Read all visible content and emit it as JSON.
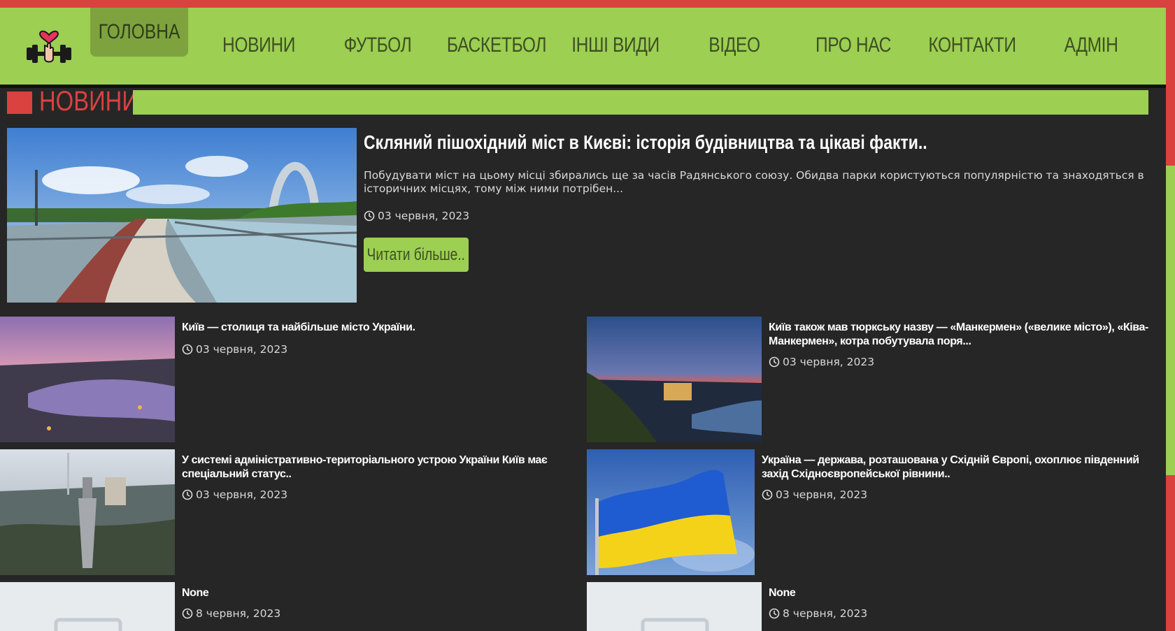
{
  "nav": {
    "items": [
      "ГОЛОВНА",
      "НОВИНИ",
      "ФУТБОЛ",
      "БАСКЕТБОЛ",
      "ІНШІ ВИДИ",
      "ВІДЕО",
      "ПРО НАС",
      "КОНТАКТИ",
      "АДМІН"
    ],
    "active_index": 0
  },
  "logo": {
    "icon": "dumbbell-heart-icon"
  },
  "section": {
    "title": "НОВИНИ"
  },
  "featured": {
    "title": "Скляний пішохідний міст в Києві: історія будівництва та цікаві факти..",
    "description": "Побудувати міст на цьому місці збирались ще за часів Радянського союзу. Обидва парки користуються популярністю та знаходяться в історичних місцях, тому між ними потрібен...",
    "date": "03 червня, 2023",
    "read_more": "Читати більше.."
  },
  "cards": [
    {
      "title": "Київ — столиця та найбільше місто України.",
      "date": "03 червня, 2023"
    },
    {
      "title": "Київ також мав тюркську назву — «Манкермен» («велике місто»), «Ківа-Манкермен», котра побутувала поря...",
      "date": "03 червня, 2023"
    },
    {
      "title": "У системі адміністративно-територіального устрою України Київ має спеціальний статус..",
      "date": "03 червня, 2023"
    },
    {
      "title": "Україна — держава, розташована у Східній Європі, охоплює південний захід Східноєвропейської рівнини..",
      "date": "03 червня, 2023"
    },
    {
      "title": "None",
      "date": "8 червня, 2023"
    },
    {
      "title": "None",
      "date": "8 червня, 2023"
    }
  ],
  "colors": {
    "accent_green": "#9ccf52",
    "accent_red": "#d9423f",
    "background": "#262626"
  }
}
